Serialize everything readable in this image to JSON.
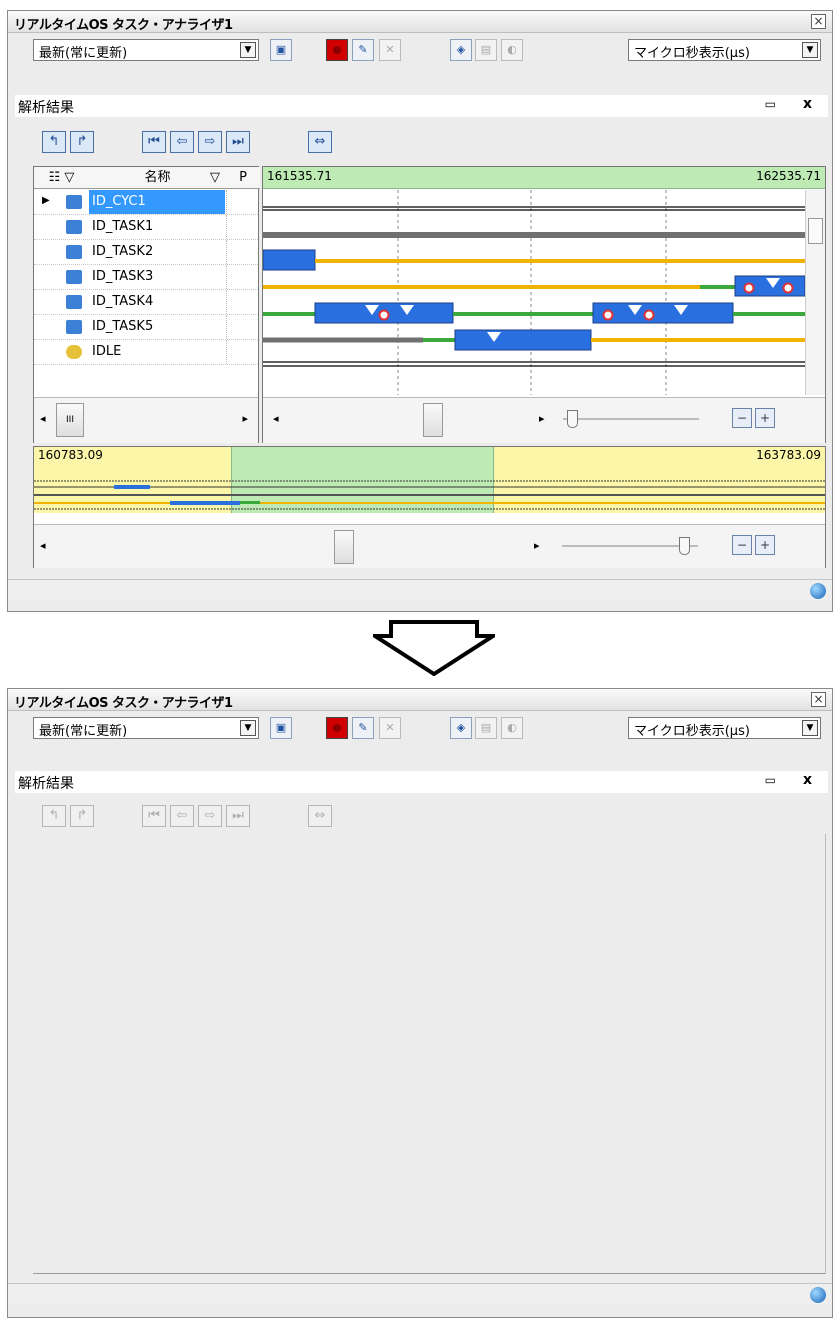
{
  "before": {
    "window_title": "リアルタイムOS タスク・アナライザ1",
    "close_glyph": "×",
    "update_mode_value": "最新(常に更新)",
    "time_unit_value": "マイクロ秒表示(μs)",
    "panel_title": "解析結果",
    "minimize_glyph": "▭",
    "panel_close_glyph": "x",
    "list_columns": {
      "name": "名称",
      "p": "P"
    },
    "scroll_left_glyph": "◂",
    "scroll_right_glyph": "▸",
    "scroll_grip": "III",
    "tasks": [
      {
        "name": "ID_CYC1",
        "icon": "cyclic-handler-icon",
        "selected": true
      },
      {
        "name": "ID_TASK1",
        "icon": "task-icon"
      },
      {
        "name": "ID_TASK2",
        "icon": "task-icon"
      },
      {
        "name": "ID_TASK3",
        "icon": "task-icon"
      },
      {
        "name": "ID_TASK4",
        "icon": "task-icon"
      },
      {
        "name": "ID_TASK5",
        "icon": "task-icon"
      },
      {
        "name": "IDLE",
        "icon": "idle-icon"
      }
    ],
    "chart_time_start": "161535.71",
    "chart_time_end": "162535.71",
    "overview_time_start": "160783.09",
    "overview_time_end": "163783.09"
  },
  "after": {
    "window_title": "リアルタイムOS タスク・アナライザ1",
    "close_glyph": "×",
    "update_mode_value": "最新(常に更新)",
    "time_unit_value": "マイクロ秒表示(μs)",
    "panel_title": "解析結果",
    "minimize_glyph": "▭",
    "panel_close_glyph": "x"
  },
  "colors": {
    "task_running": "#2a6fe0",
    "task_ready": "#f0b400",
    "task_waiting": "#3aa83a",
    "task_dormant": "#707070",
    "time_header": "#bdebb3",
    "overview_bg": "#fbf6a8"
  }
}
